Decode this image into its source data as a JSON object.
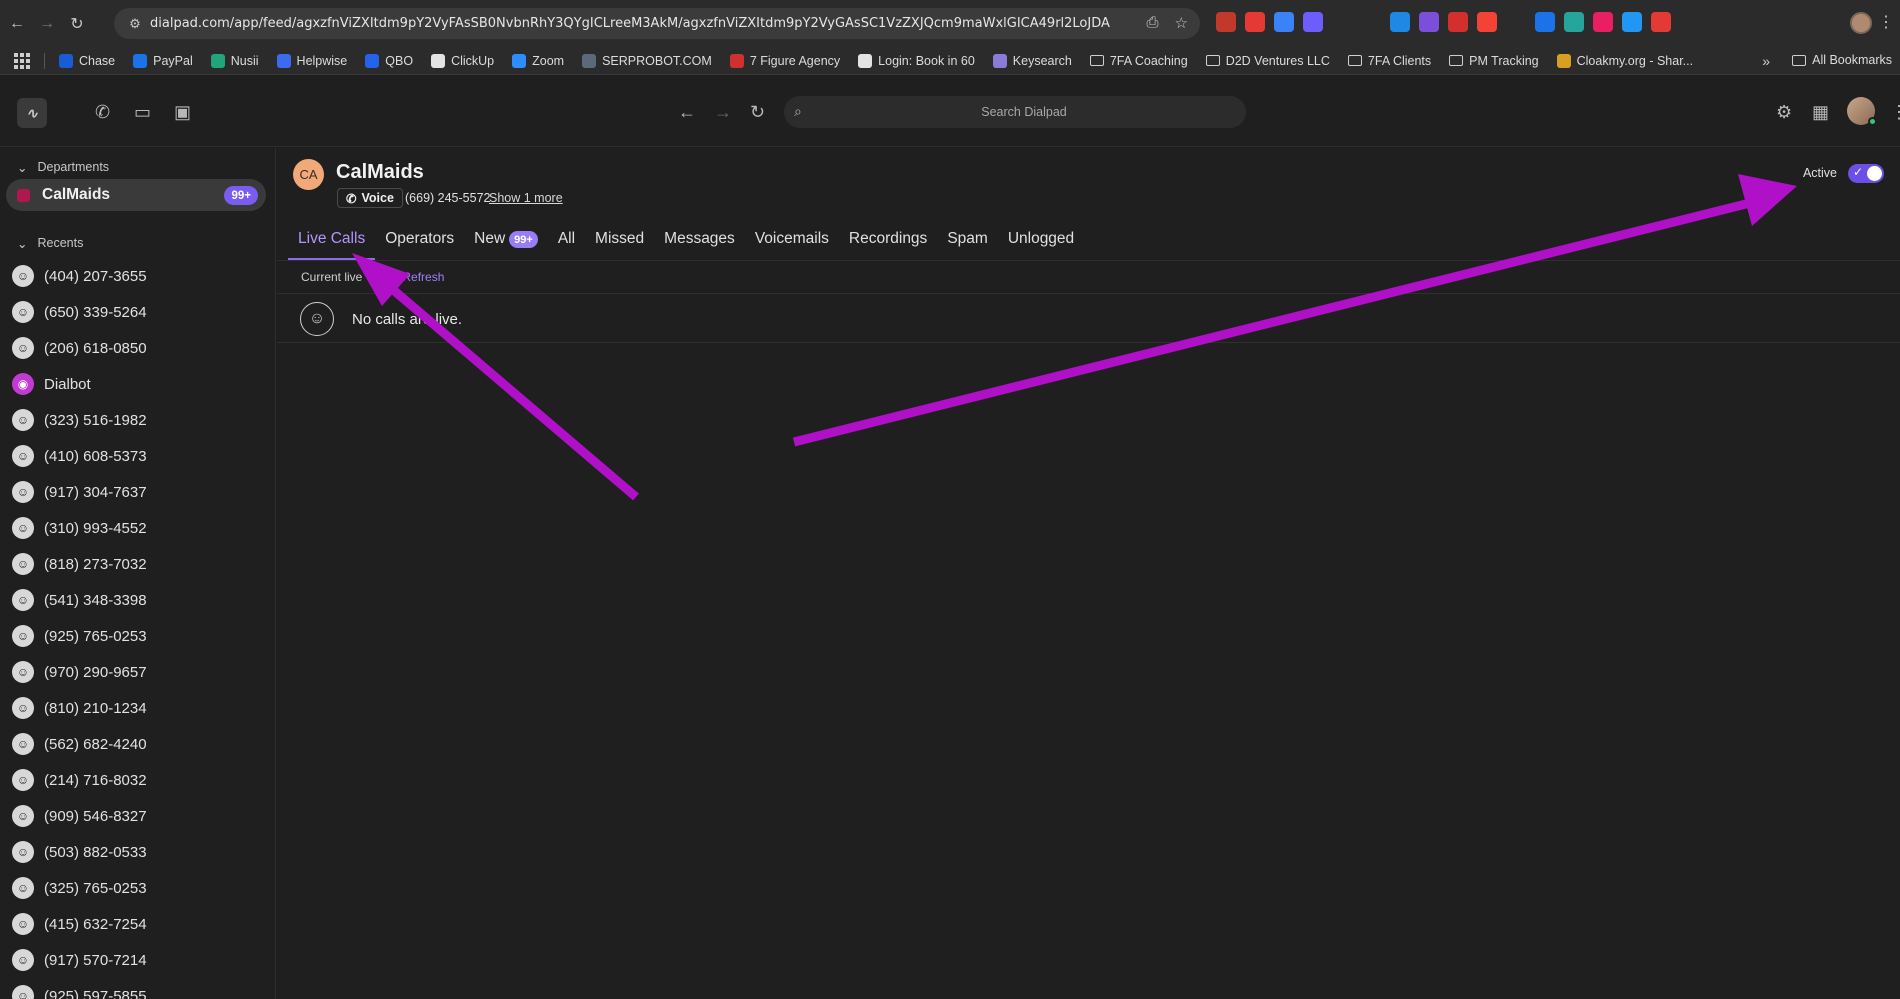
{
  "browser": {
    "url": "dialpad.com/app/feed/agxzfnViZXItdm9pY2VyFAsSB0NvbnRhY3QYgICLreeM3AkM/agxzfnViZXItdm9pY2VyGAsSC1VzZXJQcm9maWxlGICA49rl2LoJDA",
    "extension_icons": [
      "ext-1",
      "youtube",
      "play",
      "d",
      "s",
      "pen",
      "diamond",
      "v",
      "pin",
      "c",
      "dots",
      "p",
      "circle",
      "r",
      "arrow",
      "b",
      "puzzle"
    ],
    "bookmarks": [
      {
        "label": "Chase",
        "icon": "chase-icon",
        "color": "#1a5bd6"
      },
      {
        "label": "PayPal",
        "icon": "paypal-icon",
        "color": "#1a73e8"
      },
      {
        "label": "Nusii",
        "icon": "nusii-icon",
        "color": "#1fa67a"
      },
      {
        "label": "Helpwise",
        "icon": "helpwise-icon",
        "color": "#3b6cf0"
      },
      {
        "label": "QBO",
        "icon": "qbo-icon",
        "color": "#2563eb"
      },
      {
        "label": "ClickUp",
        "icon": "clickup-icon",
        "color": "#e3e3e3"
      },
      {
        "label": "Zoom",
        "icon": "zoom-icon",
        "color": "#2d8cff"
      },
      {
        "label": "SERPROBOT.COM",
        "icon": "serprobot-icon",
        "color": "#5a6a7a"
      },
      {
        "label": "7 Figure Agency",
        "icon": "seven-figure-icon",
        "color": "#d03030"
      },
      {
        "label": "Login: Book in 60",
        "icon": "book-icon",
        "color": "#e3e3e3"
      },
      {
        "label": "Keysearch",
        "icon": "keysearch-icon",
        "color": "#8a7bd8"
      },
      {
        "label": "7FA Coaching",
        "icon": "folder-icon",
        "color": ""
      },
      {
        "label": "D2D Ventures LLC",
        "icon": "folder-icon",
        "color": ""
      },
      {
        "label": "7FA Clients",
        "icon": "folder-icon",
        "color": ""
      },
      {
        "label": "PM Tracking",
        "icon": "folder-icon",
        "color": ""
      },
      {
        "label": "Cloakmy.org - Shar...",
        "icon": "cloak-icon",
        "color": "#d6a020"
      }
    ],
    "all_bookmarks": "All Bookmarks"
  },
  "header": {
    "search_placeholder": "Search Dialpad"
  },
  "sidebar": {
    "departments_label": "Departments",
    "department": {
      "name": "CalMaids",
      "badge": "99+",
      "color": "#b0174f"
    },
    "recents_label": "Recents",
    "recents": [
      {
        "label": "(404) 207-3655",
        "type": "contact"
      },
      {
        "label": "(650) 339-5264",
        "type": "contact"
      },
      {
        "label": "(206) 618-0850",
        "type": "contact"
      },
      {
        "label": "Dialbot",
        "type": "bot"
      },
      {
        "label": "(323) 516-1982",
        "type": "contact"
      },
      {
        "label": "(410) 608-5373",
        "type": "contact"
      },
      {
        "label": "(917) 304-7637",
        "type": "contact"
      },
      {
        "label": "(310) 993-4552",
        "type": "contact"
      },
      {
        "label": "(818) 273-7032",
        "type": "contact"
      },
      {
        "label": "(541) 348-3398",
        "type": "contact"
      },
      {
        "label": "(925) 765-0253",
        "type": "contact"
      },
      {
        "label": "(970) 290-9657",
        "type": "contact"
      },
      {
        "label": "(810) 210-1234",
        "type": "contact"
      },
      {
        "label": "(562) 682-4240",
        "type": "contact"
      },
      {
        "label": "(214) 716-8032",
        "type": "contact"
      },
      {
        "label": "(909) 546-8327",
        "type": "contact"
      },
      {
        "label": "(503) 882-0533",
        "type": "contact"
      },
      {
        "label": "(325) 765-0253",
        "type": "contact"
      },
      {
        "label": "(415) 632-7254",
        "type": "contact"
      },
      {
        "label": "(917) 570-7214",
        "type": "contact"
      },
      {
        "label": "(925) 597-5855",
        "type": "contact"
      }
    ]
  },
  "main": {
    "avatar_initials": "CA",
    "title": "CalMaids",
    "voice_label": "Voice",
    "phone": "(669) 245-5572",
    "show_more": "Show 1 more",
    "active_label": "Active",
    "tabs": [
      {
        "label": "Live Calls",
        "active": true,
        "badge": ""
      },
      {
        "label": "Operators",
        "active": false,
        "badge": ""
      },
      {
        "label": "New",
        "active": false,
        "badge": "99+"
      },
      {
        "label": "All",
        "active": false,
        "badge": ""
      },
      {
        "label": "Missed",
        "active": false,
        "badge": ""
      },
      {
        "label": "Messages",
        "active": false,
        "badge": ""
      },
      {
        "label": "Voicemails",
        "active": false,
        "badge": ""
      },
      {
        "label": "Recordings",
        "active": false,
        "badge": ""
      },
      {
        "label": "Spam",
        "active": false,
        "badge": ""
      },
      {
        "label": "Unlogged",
        "active": false,
        "badge": ""
      }
    ],
    "live_note": "Current live",
    "refresh_label": "Refresh",
    "empty_message": "No calls are live."
  },
  "annotation": {
    "arrow_color": "#b010c8"
  }
}
